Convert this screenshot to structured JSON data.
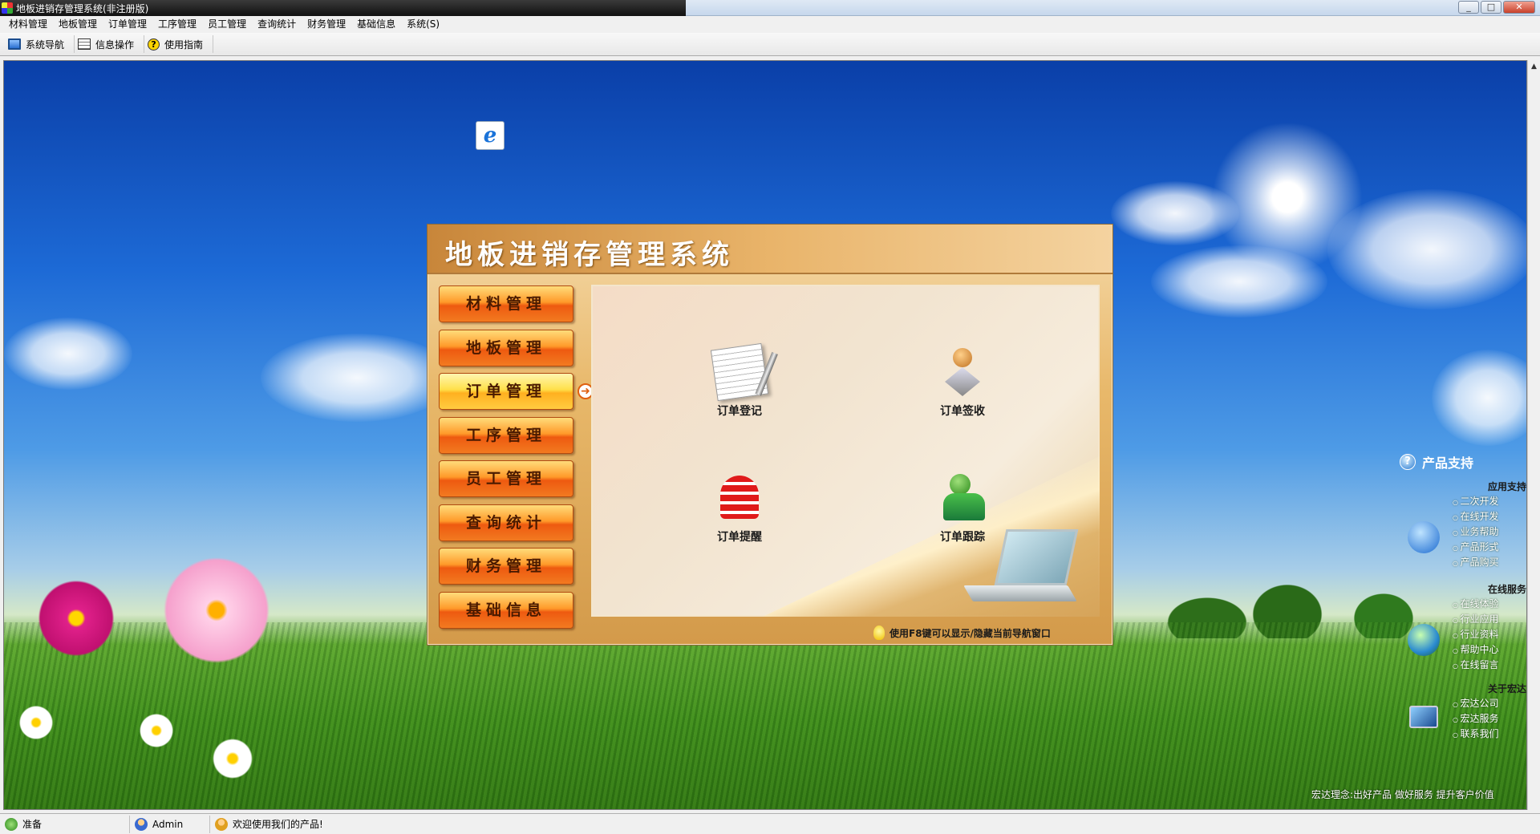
{
  "window": {
    "title": "地板进销存管理系统(非注册版)",
    "controls": [
      "minimize",
      "maximize",
      "close"
    ]
  },
  "menubar": {
    "items": [
      "材料管理",
      "地板管理",
      "订单管理",
      "工序管理",
      "员工管理",
      "查询统计",
      "财务管理",
      "基础信息",
      "系统(S)"
    ]
  },
  "toolbar": {
    "items": [
      {
        "label": "系统导航",
        "icon": "monitor-icon"
      },
      {
        "label": "信息操作",
        "icon": "form-icon"
      },
      {
        "label": "使用指南",
        "icon": "help-icon"
      }
    ]
  },
  "desktop": {
    "ie_icon": "e"
  },
  "navwin": {
    "title": "地板进销存管理系统",
    "sidebar": [
      {
        "label": "材料管理",
        "active": false
      },
      {
        "label": "地板管理",
        "active": false
      },
      {
        "label": "订单管理",
        "active": true
      },
      {
        "label": "工序管理",
        "active": false
      },
      {
        "label": "员工管理",
        "active": false
      },
      {
        "label": "查询统计",
        "active": false
      },
      {
        "label": "财务管理",
        "active": false
      },
      {
        "label": "基础信息",
        "active": false
      }
    ],
    "functions": [
      {
        "label": "订单登记",
        "icon": "document-pen-icon"
      },
      {
        "label": "订单签收",
        "icon": "user-sign-icon"
      },
      {
        "label": "订单提醒",
        "icon": "bell-icon"
      },
      {
        "label": "订单跟踪",
        "icon": "user-track-icon"
      }
    ],
    "tip": "使用F8键可以显示/隐藏当前导航窗口"
  },
  "rightpanel": {
    "header": "产品支持",
    "sections": [
      {
        "title": "应用支持",
        "items": [
          "二次开发",
          "在线开发",
          "业务帮助",
          "产品形式",
          "产品购买"
        ]
      },
      {
        "title": "在线服务",
        "items": [
          "在线体验",
          "行业应用",
          "行业资料",
          "帮助中心",
          "在线留言"
        ]
      },
      {
        "title": "关于宏达",
        "items": [
          "宏达公司",
          "宏达服务",
          "联系我们"
        ]
      }
    ],
    "footer": "宏达理念:出好产品 做好服务 提升客户价值"
  },
  "statusbar": {
    "status": "准备",
    "user": "Admin",
    "welcome": "欢迎使用我们的产品!"
  },
  "colors": {
    "accent_orange": "#ee5a10",
    "header_brown": "#c8863a",
    "sky_blue": "#1d6ad6",
    "grass_green": "#3d8a1c"
  }
}
